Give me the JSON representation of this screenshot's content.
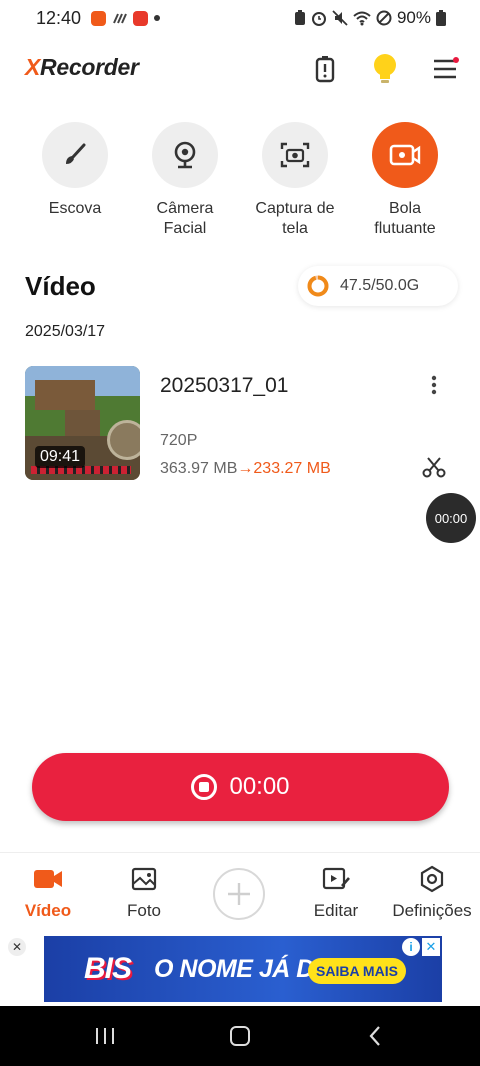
{
  "status_bar": {
    "time": "12:40",
    "battery": "90%",
    "left_icons": [
      "app-notification-icon",
      "bars-icon",
      "app-notification-icon",
      "dot-icon"
    ],
    "right_icons": [
      "battery-saver-icon",
      "alarm-icon",
      "mute-icon",
      "wifi-icon",
      "do-not-disturb-icon",
      "battery-icon"
    ]
  },
  "header": {
    "logo_x": "X",
    "logo_rest": "Recorder",
    "icons": [
      "battery-icon",
      "lightbulb-icon",
      "menu-icon"
    ],
    "accent": "#f05a1a"
  },
  "tools": [
    {
      "label": "Escova",
      "icon": "brush-icon"
    },
    {
      "label": "Câmera\nFacial",
      "icon": "webcam-icon"
    },
    {
      "label": "Captura de\ntela",
      "icon": "screenshot-icon"
    },
    {
      "label": "Bola\nflutuante",
      "icon": "floating-ball-icon"
    }
  ],
  "video_section": {
    "title": "Vídeo",
    "storage": "47.5/50.0G",
    "storage_used_fraction": 0.95,
    "date": "2025/03/17",
    "items": [
      {
        "name": "20250317_01",
        "duration": "09:41",
        "resolution": "720P",
        "size_original": "363.97 MB",
        "arrow": "→",
        "size_compressed": "233.27 MB"
      }
    ]
  },
  "float_timer": "00:00",
  "record_button": {
    "time": "00:00",
    "color": "#e9213f"
  },
  "bottom_nav": [
    {
      "label": "Vídeo",
      "icon": "video-camera-icon",
      "active": true
    },
    {
      "label": "Foto",
      "icon": "photo-icon",
      "active": false
    },
    {
      "label": "",
      "icon": "add-icon",
      "active": false
    },
    {
      "label": "Editar",
      "icon": "edit-video-icon",
      "active": false
    },
    {
      "label": "Definições",
      "icon": "settings-icon",
      "active": false
    }
  ],
  "ad": {
    "brand": "BIS",
    "tagline": "O NOME JÁ DIZ",
    "cta": "SAIBA MAIS",
    "info": "i",
    "close": "✕",
    "dismiss": "✕"
  }
}
